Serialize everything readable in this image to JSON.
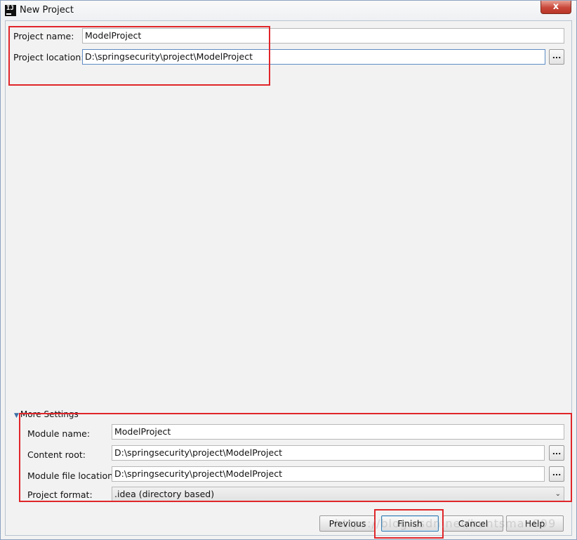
{
  "window": {
    "title": "New Project",
    "close_glyph": "x",
    "app_icon_text": "IJ"
  },
  "project": {
    "name_label": "Project name:",
    "name_value": "ModelProject",
    "location_label": "Project location:",
    "location_value": "D:\\springsecurity\\project\\ModelProject",
    "browse_label": "..."
  },
  "more_settings": {
    "title": "More Settings",
    "module_name_label": "Module name:",
    "module_name_value": "ModelProject",
    "content_root_label": "Content root:",
    "content_root_value": "D:\\springsecurity\\project\\ModelProject",
    "module_file_label": "Module file location:",
    "module_file_value": "D:\\springsecurity\\project\\ModelProject",
    "format_label": "Project format:",
    "format_value": ".idea (directory based)",
    "browse_label": "..."
  },
  "buttons": {
    "previous": "Previous",
    "finish": "Finish",
    "cancel": "Cancel",
    "help": "Help"
  },
  "watermark": "https://blog.csdn.net/huntsman999",
  "colors": {
    "highlight": "#e0262a",
    "focus": "#5d8bc5"
  }
}
